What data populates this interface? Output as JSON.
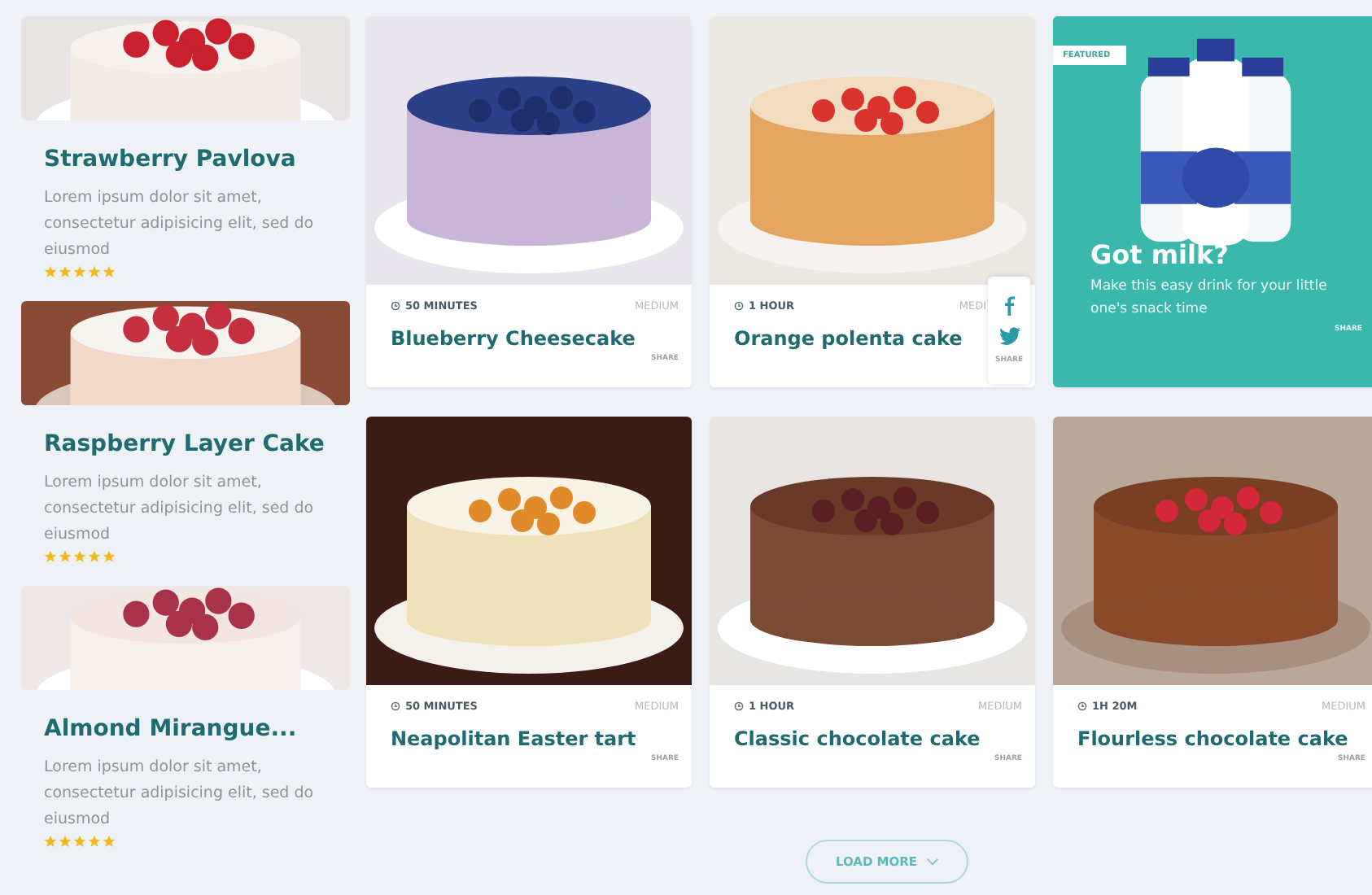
{
  "sidebar": {
    "items": [
      {
        "title": "Strawberry Pavlova",
        "text": "Lorem ipsum dolor sit amet, consectetur adipisicing elit, sed do eiusmod",
        "stars": 5
      },
      {
        "title": "Raspberry Layer Cake",
        "text": "Lorem ipsum dolor sit amet, consectetur adipisicing elit, sed do eiusmod",
        "stars": 5
      },
      {
        "title": "Almond Mirangue...",
        "text": "Lorem ipsum dolor sit amet, consectetur adipisicing elit, sed do eiusmod",
        "stars": 5
      }
    ]
  },
  "cards": [
    {
      "kind": "recipe",
      "time": "50 MINUTES",
      "difficulty": "MEDIUM",
      "title": "Blueberry Cheesecake",
      "share_label": "SHARE",
      "share_open": false
    },
    {
      "kind": "recipe",
      "time": "1 HOUR",
      "difficulty": "MEDI",
      "title": "Orange polenta cake",
      "share_label": "SHARE",
      "share_open": true
    },
    {
      "kind": "featured",
      "badge": "FEATURED",
      "title": "Got milk?",
      "text": "Make this easy drink for your little one's snack time",
      "share_label": "SHARE"
    },
    {
      "kind": "recipe",
      "time": "50 MINUTES",
      "difficulty": "MEDIUM",
      "title": "Neapolitan Easter tart",
      "share_label": "SHARE",
      "share_open": false
    },
    {
      "kind": "recipe",
      "time": "1 HOUR",
      "difficulty": "MEDIUM",
      "title": "Classic chocolate cake",
      "share_label": "SHARE",
      "share_open": false
    },
    {
      "kind": "recipe",
      "time": "1H 20M",
      "difficulty": "MEDIUM",
      "title": "Flourless chocolate cake",
      "share_label": "SHARE",
      "share_open": false
    }
  ],
  "load_more": {
    "label": "LOAD MORE"
  }
}
